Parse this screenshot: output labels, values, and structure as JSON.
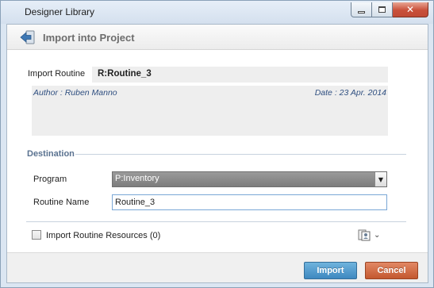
{
  "window": {
    "title": "Designer Library"
  },
  "header": {
    "title": "Import into Project"
  },
  "routine": {
    "label": "Import Routine",
    "name": "R:Routine_3",
    "author": "Author : Ruben Manno",
    "date": "Date : 23 Apr. 2014"
  },
  "destination": {
    "section_title": "Destination",
    "program_label": "Program",
    "program_value": "P:Inventory",
    "routine_name_label": "Routine Name",
    "routine_name_value": "Routine_3"
  },
  "resources": {
    "checkbox_label": "Import Routine Resources (0)",
    "checked": false
  },
  "footer": {
    "import_label": "Import",
    "cancel_label": "Cancel"
  },
  "colors": {
    "import_button": "#3e88c0",
    "cancel_button": "#c3582f",
    "section_title": "#5a7290",
    "meta_text": "#2f4f80"
  },
  "icons": {
    "header": "import-arrow-icon",
    "resources": "resources-icon",
    "resources_dropdown": "chevron-down-icon",
    "select_dropdown": "dropdown-arrow-icon"
  }
}
